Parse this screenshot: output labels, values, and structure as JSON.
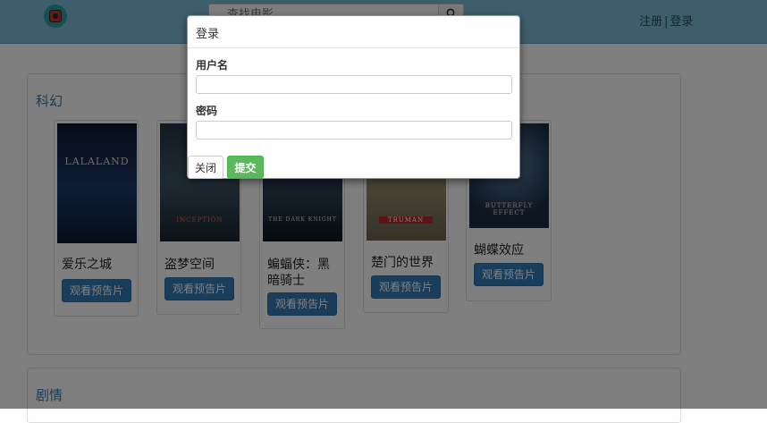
{
  "navbar": {
    "search": {
      "placeholder": "查找电影"
    },
    "register": "注册",
    "separator": "|",
    "login": "登录"
  },
  "sections": [
    {
      "title": "科幻",
      "movies": [
        {
          "title_line1": "爱乐之城",
          "title_line2": "",
          "poster_text": "LALALAND",
          "button": "观看预告片"
        },
        {
          "title_line1": "盗梦空间",
          "title_line2": "",
          "poster_text": "INCEPTION",
          "button": "观看预告片"
        },
        {
          "title_line1": "蝙蝠侠：黑",
          "title_line2": "暗骑士",
          "poster_text": "THE DARK KNIGHT",
          "button": "观看预告片"
        },
        {
          "title_line1": "楚门的世界",
          "title_line2": "",
          "poster_text": "TRUMAN",
          "button": "观看预告片"
        },
        {
          "title_line1": "蝴蝶效应",
          "title_line2": "",
          "poster_text": "BUTTERFLY EFFECT",
          "button": "观看预告片"
        }
      ]
    },
    {
      "title": "剧情"
    }
  ],
  "modal": {
    "title": "登录",
    "username_label": "用户名",
    "username_value": "",
    "password_label": "密码",
    "password_value": "",
    "close_label": "关闭",
    "submit_label": "提交"
  },
  "colors": {
    "navbar": "#7fbcd9",
    "primary": "#337ab7",
    "success": "#5cb85c",
    "backdrop": "rgba(0,0,0,0.5)"
  }
}
